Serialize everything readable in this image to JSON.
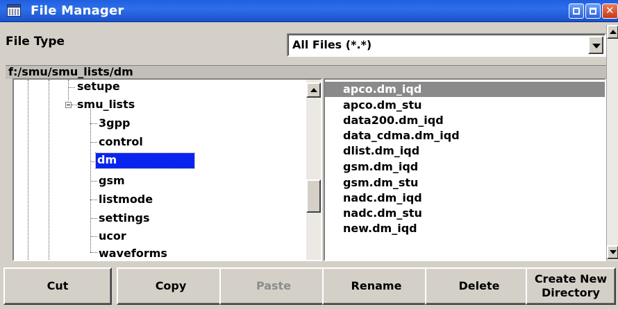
{
  "window": {
    "title": "File Manager",
    "icon": "file-manager-icon"
  },
  "file_type": {
    "label": "File Type",
    "selected": "All Files (*.*)"
  },
  "path": "f:/smu/smu_lists/dm",
  "tree": {
    "items": [
      {
        "label": "setupe"
      },
      {
        "label": "smu_lists"
      },
      {
        "label": "3gpp"
      },
      {
        "label": "control"
      },
      {
        "label": "dm",
        "selected": true
      },
      {
        "label": "gsm"
      },
      {
        "label": "listmode"
      },
      {
        "label": "settings"
      },
      {
        "label": "ucor"
      },
      {
        "label": "waveforms"
      }
    ]
  },
  "files": [
    {
      "name": "apco.dm_iqd",
      "selected": true
    },
    {
      "name": "apco.dm_stu"
    },
    {
      "name": "data200.dm_iqd"
    },
    {
      "name": "data_cdma.dm_iqd"
    },
    {
      "name": "dlist.dm_iqd"
    },
    {
      "name": "gsm.dm_iqd"
    },
    {
      "name": "gsm.dm_stu"
    },
    {
      "name": "nadc.dm_iqd"
    },
    {
      "name": "nadc.dm_stu"
    },
    {
      "name": "new.dm_iqd"
    }
  ],
  "buttons": {
    "cut": "Cut",
    "copy": "Copy",
    "paste": "Paste",
    "rename": "Rename",
    "delete": "Delete",
    "create_line1": "Create New",
    "create_line2": "Directory"
  },
  "colors": {
    "title_bar": "#2d6fea",
    "tree_selection": "#0a24f0",
    "list_selection": "#8a8a8a"
  }
}
